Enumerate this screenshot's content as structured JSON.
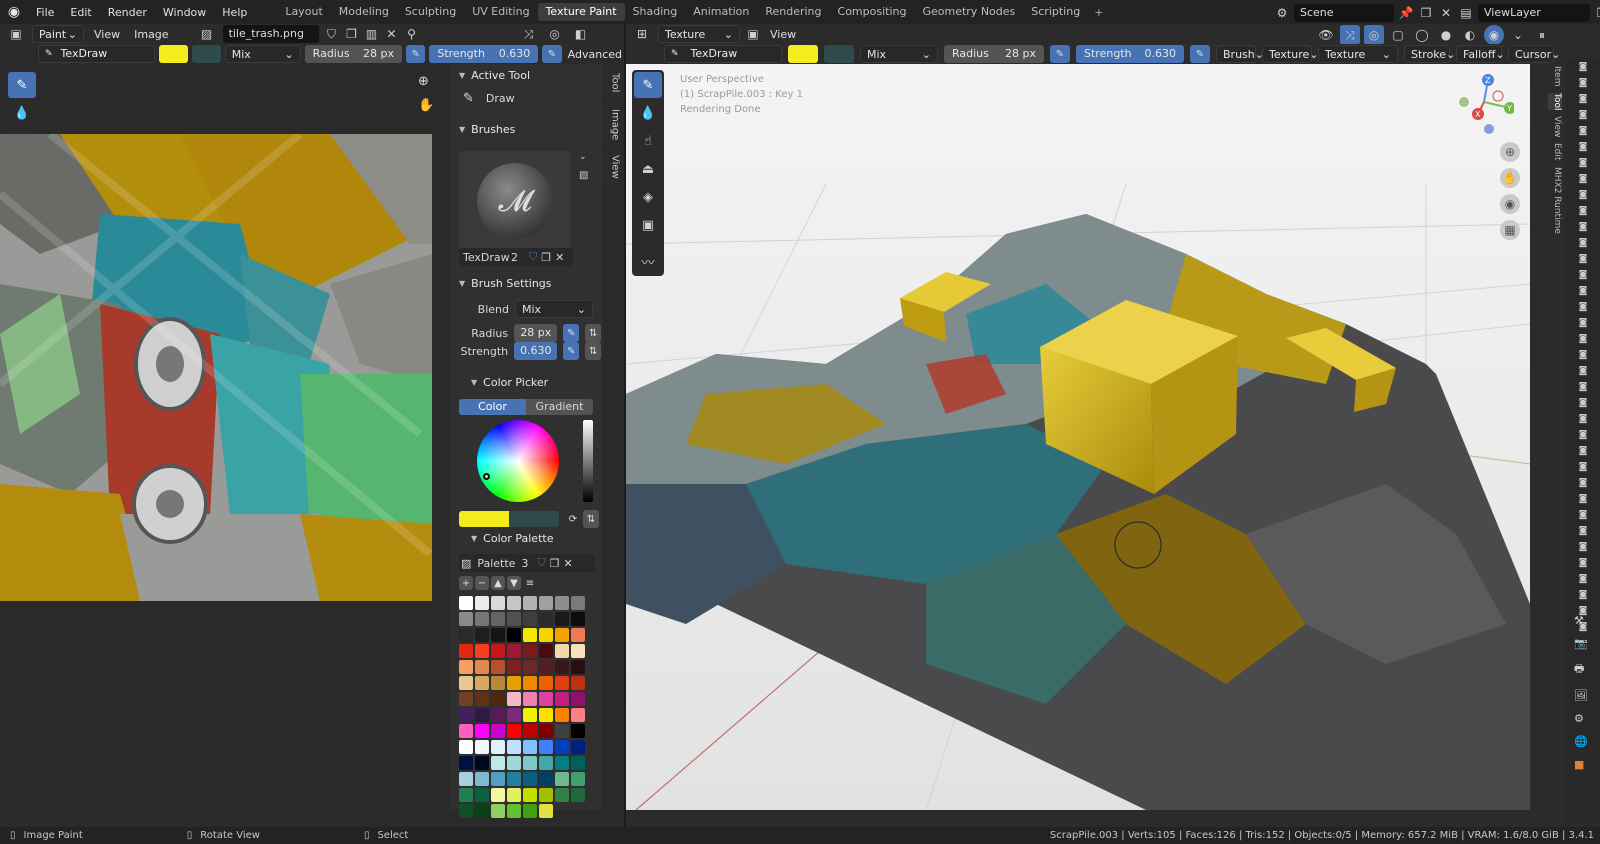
{
  "menu": {
    "items": [
      "File",
      "Edit",
      "Render",
      "Window",
      "Help"
    ]
  },
  "workspaces": [
    "Layout",
    "Modeling",
    "Sculpting",
    "UV Editing",
    "Texture Paint",
    "Shading",
    "Animation",
    "Rendering",
    "Compositing",
    "Geometry Nodes",
    "Scripting"
  ],
  "active_workspace": "Texture Paint",
  "scene": {
    "label": "Scene",
    "viewlayer": "ViewLayer"
  },
  "image_editor": {
    "mode": "Paint",
    "view_label": "View",
    "image_label": "Image",
    "image_name": "tile_trash.png",
    "brush_name": "TexDraw",
    "blend": "Mix",
    "radius_label": "Radius",
    "radius_value": "28 px",
    "strength_label": "Strength",
    "strength_value": "0.630",
    "advanced_label": "Advanced"
  },
  "npanel": {
    "active_tool_title": "Active Tool",
    "active_tool": "Draw",
    "brushes_title": "Brushes",
    "brush_name": "TexDraw",
    "brush_users": "2",
    "brush_settings_title": "Brush Settings",
    "blend_label": "Blend",
    "blend_value": "Mix",
    "radius_label": "Radius",
    "radius_value": "28 px",
    "strength_label": "Strength",
    "strength_value": "0.630",
    "color_picker_title": "Color Picker",
    "color_tab": "Color",
    "gradient_tab": "Gradient",
    "color_palette_title": "Color Palette",
    "palette_name": "Palette",
    "palette_users": "3",
    "tabs": [
      "Tool",
      "Image",
      "View"
    ]
  },
  "viewport": {
    "mode": "Texture Paint",
    "view_label": "View",
    "brush_name": "TexDraw",
    "blend": "Mix",
    "radius_label": "Radius",
    "radius_value": "28 px",
    "strength_label": "Strength",
    "strength_value": "0.630",
    "menus": [
      "Brush",
      "Texture",
      "Texture Mask",
      "Stroke",
      "Falloff",
      "Cursor"
    ],
    "overlay_lines": [
      "User Perspective",
      "(1) ScrapPile.003 : Key 1",
      "Rendering Done"
    ],
    "side_tabs": [
      "Item",
      "Tool",
      "View",
      "Edit",
      "MHX2 Runtime"
    ],
    "gizmo": {
      "z": "Z",
      "y": "Y",
      "x": "X"
    }
  },
  "status": {
    "left": "Image Paint",
    "middle": "Rotate View",
    "right": "Select",
    "stats": "ScrapPile.003 | Verts:105 | Faces:126 | Tris:152 | Objects:0/5 | Memory: 657.2 MiB | VRAM: 1.6/8.0 GiB | 3.4.1"
  },
  "colors": {
    "primary": "#f5ec1e",
    "secondary": "#2f4a4a",
    "accent": "#4772b3"
  },
  "palette_colors": [
    "#ffffff",
    "#ececec",
    "#d9d9d9",
    "#c6c6c6",
    "#b3b3b3",
    "#a0a0a0",
    "#8d8d8d",
    "#7a7a7a",
    "#8a8a8a",
    "#777777",
    "#646464",
    "#515151",
    "#3e3e3e",
    "#2b2b2b",
    "#1a1a1a",
    "#0d0d0d",
    "#2a2a2a",
    "#1e1e1e",
    "#151515",
    "#000000",
    "#f3e800",
    "#f5d500",
    "#f3a300",
    "#f07a55",
    "#e02a10",
    "#f44020",
    "#c81616",
    "#a01830",
    "#7a1a1a",
    "#4a0a10",
    "#f2d8a8",
    "#f8e2b8",
    "#f5a060",
    "#e08850",
    "#b85030",
    "#802020",
    "#6a2a2a",
    "#502020",
    "#3a1818",
    "#281010",
    "#e8c890",
    "#d8a860",
    "#b88838",
    "#e8a000",
    "#f08800",
    "#f06000",
    "#e04010",
    "#c03010",
    "#704020",
    "#603018",
    "#502810",
    "#f4b8c8",
    "#f080b0",
    "#e040a0",
    "#c02080",
    "#901070",
    "#402060",
    "#301848",
    "#5a1a5a",
    "#7a2a7a",
    "#f0f000",
    "#ffe000",
    "#ff8000",
    "#ff8080",
    "#ff60c0",
    "#ff00ff",
    "#d000d0",
    "#ff0000",
    "#c00000",
    "#800000",
    "#404040",
    "#000000",
    "#ffffff",
    "#f0f8ff",
    "#e0f0ff",
    "#c0e0ff",
    "#80c0ff",
    "#4080ff",
    "#0040c0",
    "#002080",
    "#001040",
    "#000820",
    "#c0e8e8",
    "#a0d8d8",
    "#80c8c8",
    "#40a8a8",
    "#008080",
    "#006060",
    "#a8d0e0",
    "#80b8d0",
    "#50a0c0",
    "#2080a0",
    "#0a6080",
    "#004060",
    "#70b890",
    "#40a070",
    "#208050",
    "#0a6040",
    "#f0f8a0",
    "#e0f060",
    "#c0e000",
    "#a0c000",
    "#308048",
    "#206838",
    "#105028",
    "#084018",
    "#90d060",
    "#60c030",
    "#40a010",
    "#e0e040"
  ]
}
